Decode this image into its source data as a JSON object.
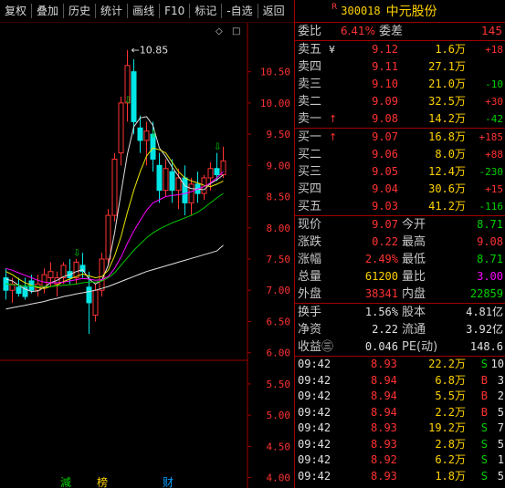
{
  "toolbar": [
    "复权",
    "叠加",
    "历史",
    "统计",
    "画线",
    "F10",
    "标记",
    "-自选",
    "返回"
  ],
  "chart_data": {
    "type": "candlestick",
    "y_ticks": [
      "10.50",
      "10.00",
      "9.50",
      "9.00",
      "8.50",
      "8.00",
      "7.50",
      "7.00",
      "6.50",
      "6.00",
      "5.50",
      "5.00",
      "4.50",
      "4.00"
    ],
    "ylim": [
      3.95,
      11.05
    ],
    "high_label": "10.85",
    "candles": [
      {
        "o": 7.2,
        "h": 7.35,
        "l": 6.85,
        "c": 7.0
      },
      {
        "o": 7.0,
        "h": 7.2,
        "l": 6.8,
        "c": 7.1
      },
      {
        "o": 7.05,
        "h": 7.2,
        "l": 6.9,
        "c": 6.95
      },
      {
        "o": 7.05,
        "h": 7.2,
        "l": 6.85,
        "c": 6.9
      },
      {
        "o": 7.15,
        "h": 7.25,
        "l": 6.95,
        "c": 7.0
      },
      {
        "o": 7.0,
        "h": 7.25,
        "l": 6.9,
        "c": 7.1
      },
      {
        "o": 7.05,
        "h": 7.35,
        "l": 6.95,
        "c": 7.25
      },
      {
        "o": 7.2,
        "h": 7.45,
        "l": 7.05,
        "c": 7.3
      },
      {
        "o": 7.1,
        "h": 7.3,
        "l": 6.9,
        "c": 7.2
      },
      {
        "o": 7.2,
        "h": 7.45,
        "l": 7.1,
        "c": 7.4
      },
      {
        "o": 7.3,
        "h": 7.5,
        "l": 7.1,
        "c": 7.2
      },
      {
        "o": 7.2,
        "h": 7.5,
        "l": 7.1,
        "c": 7.45
      },
      {
        "o": 7.4,
        "h": 7.6,
        "l": 7.2,
        "c": 7.3
      },
      {
        "o": 7.05,
        "h": 7.3,
        "l": 6.3,
        "c": 6.8
      },
      {
        "o": 6.6,
        "h": 7.1,
        "l": 6.5,
        "c": 7.0
      },
      {
        "o": 7.0,
        "h": 7.6,
        "l": 6.9,
        "c": 7.5
      },
      {
        "o": 7.5,
        "h": 8.3,
        "l": 7.4,
        "c": 8.2
      },
      {
        "o": 8.2,
        "h": 9.2,
        "l": 8.1,
        "c": 9.1
      },
      {
        "o": 9.2,
        "h": 10.1,
        "l": 9.0,
        "c": 10.0
      },
      {
        "o": 10.0,
        "h": 10.85,
        "l": 9.7,
        "c": 10.6
      },
      {
        "o": 10.5,
        "h": 10.7,
        "l": 9.5,
        "c": 9.7
      },
      {
        "o": 9.6,
        "h": 9.8,
        "l": 9.2,
        "c": 9.4
      },
      {
        "o": 9.4,
        "h": 9.7,
        "l": 9.0,
        "c": 9.55
      },
      {
        "o": 9.5,
        "h": 9.7,
        "l": 8.9,
        "c": 9.1
      },
      {
        "o": 9.0,
        "h": 9.2,
        "l": 8.4,
        "c": 8.6
      },
      {
        "o": 8.6,
        "h": 9.1,
        "l": 8.5,
        "c": 8.95
      },
      {
        "o": 8.9,
        "h": 9.1,
        "l": 8.4,
        "c": 8.6
      },
      {
        "o": 8.6,
        "h": 8.95,
        "l": 8.3,
        "c": 8.8
      },
      {
        "o": 8.8,
        "h": 9.0,
        "l": 8.2,
        "c": 8.4
      },
      {
        "o": 8.4,
        "h": 8.8,
        "l": 8.2,
        "c": 8.7
      },
      {
        "o": 8.7,
        "h": 8.9,
        "l": 8.4,
        "c": 8.55
      },
      {
        "o": 8.55,
        "h": 8.85,
        "l": 8.45,
        "c": 8.8
      },
      {
        "o": 8.8,
        "h": 9.05,
        "l": 8.6,
        "c": 8.95
      },
      {
        "o": 8.95,
        "h": 9.2,
        "l": 8.75,
        "c": 8.85
      },
      {
        "o": 8.85,
        "h": 9.3,
        "l": 8.8,
        "c": 9.07
      }
    ],
    "ma_lines": [
      {
        "color": "#e0e0e0",
        "values": [
          7.18,
          7.15,
          7.08,
          7.02,
          6.98,
          6.99,
          7.05,
          7.12,
          7.16,
          7.22,
          7.25,
          7.3,
          7.33,
          7.18,
          7.1,
          7.16,
          7.4,
          7.92,
          8.56,
          9.18,
          9.62,
          9.76,
          9.78,
          9.64,
          9.28,
          9.14,
          8.97,
          8.83,
          8.67,
          8.63,
          8.62,
          8.61,
          8.71,
          8.77,
          8.85
        ]
      },
      {
        "color": "#e8e800",
        "values": [
          7.3,
          7.25,
          7.18,
          7.12,
          7.08,
          7.04,
          7.03,
          7.06,
          7.08,
          7.14,
          7.18,
          7.22,
          7.26,
          7.23,
          7.2,
          7.22,
          7.32,
          7.55,
          7.86,
          8.25,
          8.6,
          8.9,
          9.15,
          9.28,
          9.25,
          9.2,
          9.05,
          8.9,
          8.8,
          8.75,
          8.72,
          8.68,
          8.66,
          8.7,
          8.75
        ]
      },
      {
        "color": "#ff00ff",
        "values": [
          7.35,
          7.32,
          7.28,
          7.24,
          7.2,
          7.16,
          7.13,
          7.12,
          7.12,
          7.13,
          7.15,
          7.17,
          7.19,
          7.18,
          7.16,
          7.17,
          7.22,
          7.35,
          7.53,
          7.75,
          7.95,
          8.12,
          8.28,
          8.4,
          8.45,
          8.5,
          8.52,
          8.53,
          8.55,
          8.58,
          8.62,
          8.66,
          8.72,
          8.8,
          8.9
        ]
      },
      {
        "color": "#00c800",
        "values": [
          7.1,
          7.09,
          7.08,
          7.07,
          7.07,
          7.06,
          7.06,
          7.06,
          7.07,
          7.08,
          7.09,
          7.1,
          7.12,
          7.13,
          7.13,
          7.15,
          7.2,
          7.28,
          7.4,
          7.52,
          7.64,
          7.74,
          7.84,
          7.92,
          7.98,
          8.03,
          8.08,
          8.12,
          8.16,
          8.2,
          8.25,
          8.32,
          8.4,
          8.48,
          8.55
        ]
      },
      {
        "color": "#e0e0e0",
        "values": [
          6.7,
          6.72,
          6.74,
          6.76,
          6.78,
          6.8,
          6.82,
          6.85,
          6.87,
          6.9,
          6.92,
          6.94,
          6.96,
          6.98,
          7.0,
          7.03,
          7.06,
          7.1,
          7.14,
          7.18,
          7.22,
          7.26,
          7.3,
          7.33,
          7.36,
          7.39,
          7.42,
          7.45,
          7.48,
          7.51,
          7.54,
          7.57,
          7.6,
          7.63,
          7.72
        ]
      }
    ],
    "bottom_marks": [
      "減",
      "榜",
      "财"
    ]
  },
  "quote": {
    "indicator": "R",
    "code": "300018",
    "name": "中元股份",
    "weibi_label": "委比",
    "weibi_value": "6.41%",
    "weicha_label": "委差",
    "weicha_value": "145",
    "asks": [
      {
        "label": "卖五",
        "mark": "¥",
        "price": "9.12",
        "vol": "1.6万",
        "chg": "+18"
      },
      {
        "label": "卖四",
        "mark": "",
        "price": "9.11",
        "vol": "27.1万",
        "chg": ""
      },
      {
        "label": "卖三",
        "mark": "",
        "price": "9.10",
        "vol": "21.0万",
        "chg": "-10"
      },
      {
        "label": "卖二",
        "mark": "",
        "price": "9.09",
        "vol": "32.5万",
        "chg": "+30"
      },
      {
        "label": "卖一",
        "mark": "↑",
        "price": "9.08",
        "vol": "14.2万",
        "chg": "-42"
      }
    ],
    "bids": [
      {
        "label": "买一",
        "mark": "↑",
        "price": "9.07",
        "vol": "16.8万",
        "chg": "+185"
      },
      {
        "label": "买二",
        "mark": "",
        "price": "9.06",
        "vol": "8.0万",
        "chg": "+88"
      },
      {
        "label": "买三",
        "mark": "",
        "price": "9.05",
        "vol": "12.4万",
        "chg": "-230"
      },
      {
        "label": "买四",
        "mark": "",
        "price": "9.04",
        "vol": "30.6万",
        "chg": "+15"
      },
      {
        "label": "买五",
        "mark": "",
        "price": "9.03",
        "vol": "41.2万",
        "chg": "-116"
      }
    ],
    "stats": [
      {
        "l1": "现价",
        "v1": "9.07",
        "l2": "今开",
        "v2": "8.71"
      },
      {
        "l1": "涨跌",
        "v1": "0.22",
        "l2": "最高",
        "v2": "9.08"
      },
      {
        "l1": "涨幅",
        "v1": "2.49%",
        "l2": "最低",
        "v2": "8.71"
      },
      {
        "l1": "总量",
        "v1": "61200",
        "l2": "量比",
        "v2": "3.00"
      },
      {
        "l1": "外盘",
        "v1": "38341",
        "l2": "内盘",
        "v2": "22859"
      }
    ],
    "finance": [
      {
        "l1": "换手",
        "v1": "1.56%",
        "l2": "股本",
        "v2": "4.81亿"
      },
      {
        "l1": "净资",
        "v1": "2.22",
        "l2": "流通",
        "v2": "3.92亿"
      },
      {
        "l1": "收益㊂",
        "v1": "0.046",
        "l2": "PE(动)",
        "v2": "148.6"
      }
    ]
  },
  "ticks": [
    {
      "time": "09:42",
      "price": "8.93",
      "vol": "22.2万",
      "bs": "S",
      "n": "10"
    },
    {
      "time": "09:42",
      "price": "8.94",
      "vol": "6.8万",
      "bs": "B",
      "n": "3"
    },
    {
      "time": "09:42",
      "price": "8.94",
      "vol": "5.5万",
      "bs": "B",
      "n": "2"
    },
    {
      "time": "09:42",
      "price": "8.94",
      "vol": "2.2万",
      "bs": "B",
      "n": "5"
    },
    {
      "time": "09:42",
      "price": "8.93",
      "vol": "19.2万",
      "bs": "S",
      "n": "7"
    },
    {
      "time": "09:42",
      "price": "8.93",
      "vol": "2.8万",
      "bs": "S",
      "n": "5"
    },
    {
      "time": "09:42",
      "price": "8.92",
      "vol": "6.2万",
      "bs": "S",
      "n": "1"
    },
    {
      "time": "09:42",
      "price": "8.93",
      "vol": "1.8万",
      "bs": "S",
      "n": "5"
    }
  ]
}
